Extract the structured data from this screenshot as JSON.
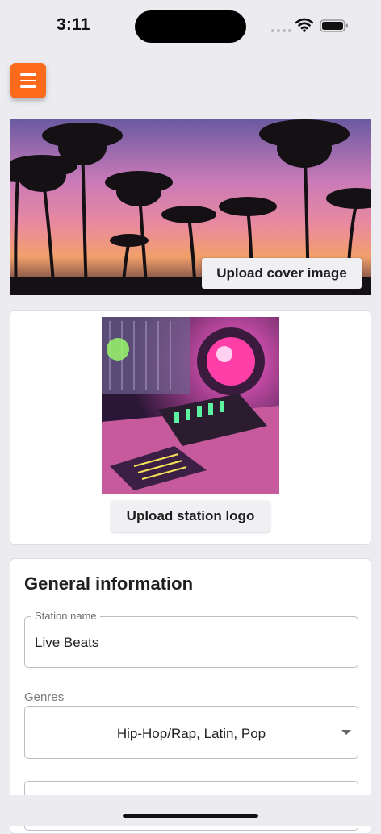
{
  "status_bar": {
    "time": "3:11"
  },
  "menu": {
    "icon": "hamburger-icon",
    "color": "#fd6a1b"
  },
  "cover": {
    "upload_label": "Upload cover image"
  },
  "logo": {
    "upload_label": "Upload station logo"
  },
  "general": {
    "title": "General information",
    "station_name_label": "Station name",
    "station_name_value": "Live Beats",
    "genres_label": "Genres",
    "genres_value": "Hip-Hop/Rap, Latin, Pop"
  }
}
